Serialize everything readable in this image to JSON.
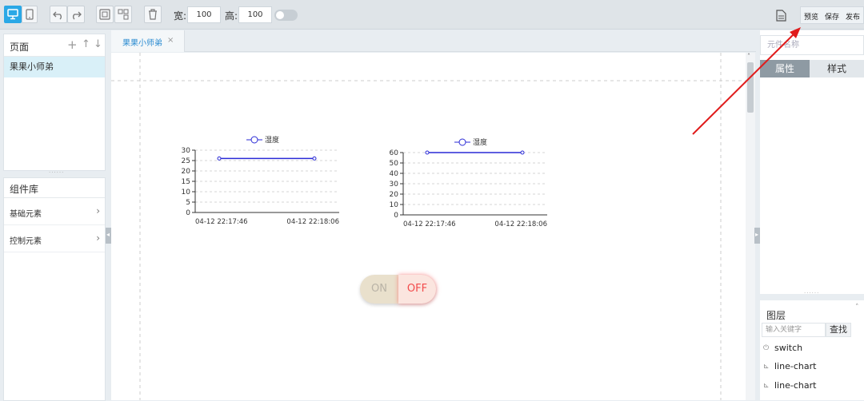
{
  "toolbar": {
    "width_label": "宽:",
    "width_value": "100",
    "height_label": "高:",
    "height_value": "100",
    "preview_label": "预览",
    "save_label": "保存",
    "publish_label": "发布"
  },
  "pages_panel": {
    "title": "页面",
    "items": [
      {
        "label": "果果小师弟"
      }
    ]
  },
  "library_panel": {
    "title": "组件库",
    "items": [
      {
        "label": "基础元素"
      },
      {
        "label": "控制元素"
      }
    ]
  },
  "canvas": {
    "tab_label": "果果小师弟",
    "tab_close": "×"
  },
  "chart_data": [
    {
      "type": "line",
      "series": [
        {
          "name": "湿度",
          "x": [
            "04-12 22:17:46",
            "04-12 22:18:06"
          ],
          "values": [
            26,
            26
          ]
        }
      ],
      "x_tick_labels": [
        "04-12 22:17:46",
        "04-12 22:18:06"
      ],
      "ylim": [
        0,
        30
      ],
      "y_ticks": [
        0,
        5,
        10,
        15,
        20,
        25,
        30
      ],
      "grid": true,
      "legend_position": "top-center",
      "color": "#2a2ad6"
    },
    {
      "type": "line",
      "series": [
        {
          "name": "湿度",
          "x": [
            "04-12 22:17:46",
            "04-12 22:18:06"
          ],
          "values": [
            60,
            60
          ]
        }
      ],
      "x_tick_labels": [
        "04-12 22:17:46",
        "04-12 22:18:06"
      ],
      "ylim": [
        0,
        60
      ],
      "y_ticks": [
        0,
        10,
        20,
        30,
        40,
        50,
        60
      ],
      "grid": true,
      "legend_position": "top-center",
      "color": "#2a2ad6"
    }
  ],
  "switch": {
    "on_label": "ON",
    "off_label": "OFF",
    "state": "off"
  },
  "right_panel": {
    "name_placeholder": "元件名称",
    "tab_properties": "属性",
    "tab_style": "样式"
  },
  "layers": {
    "title": "图层",
    "search_placeholder": "输入关键字",
    "find_label": "查找",
    "items": [
      {
        "label": "switch",
        "icon": "power-icon"
      },
      {
        "label": "line-chart",
        "icon": "chart-icon"
      },
      {
        "label": "line-chart",
        "icon": "chart-icon"
      }
    ]
  }
}
